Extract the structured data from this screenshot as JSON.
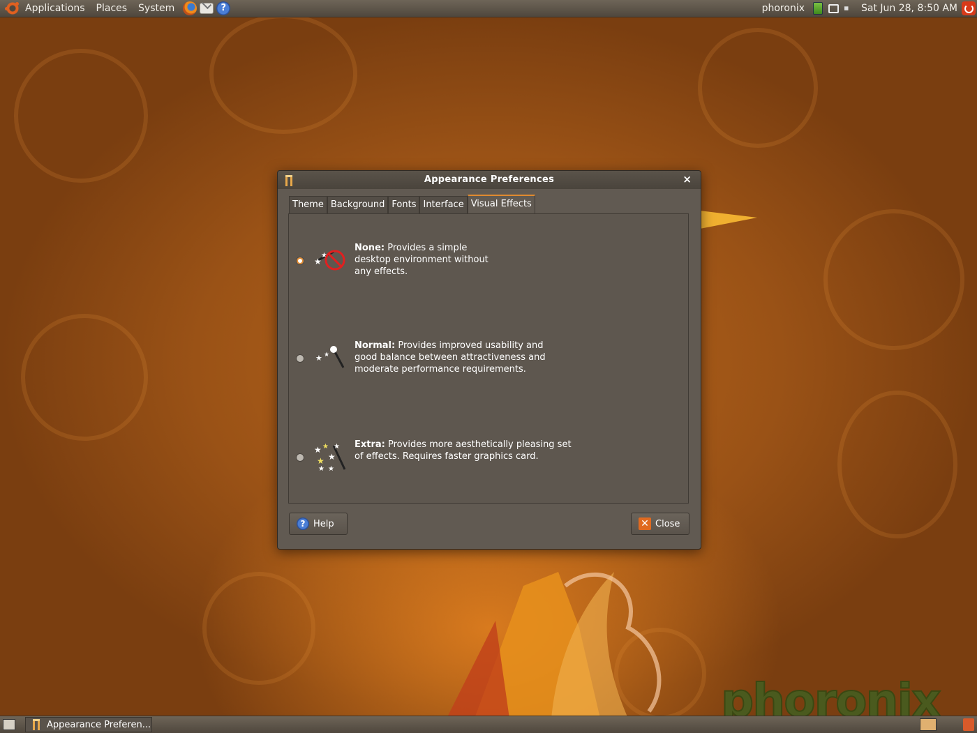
{
  "top_panel": {
    "menus": [
      "Applications",
      "Places",
      "System"
    ],
    "user": "phoronix",
    "clock": "Sat Jun 28,  8:50 AM",
    "icons": [
      "ubuntu-logo",
      "firefox-icon",
      "mail-icon",
      "help-icon",
      "battery-icon",
      "network-icon",
      "volume-icon",
      "power-icon"
    ]
  },
  "dialog": {
    "title": "Appearance Preferences",
    "close_glyph": "×",
    "tabs": [
      {
        "label": "Theme",
        "active": false
      },
      {
        "label": "Background",
        "active": false
      },
      {
        "label": "Fonts",
        "active": false
      },
      {
        "label": "Interface",
        "active": false
      },
      {
        "label": "Visual Effects",
        "active": true
      }
    ],
    "options": [
      {
        "key": "None:",
        "lines": [
          "Provides a simple",
          "desktop environment without",
          "any effects."
        ],
        "selected": true,
        "icon": "no-effects-icon"
      },
      {
        "key": "Normal:",
        "lines": [
          "Provides improved usability and",
          "good balance between attractiveness and",
          "moderate performance requirements."
        ],
        "selected": false,
        "icon": "normal-effects-icon"
      },
      {
        "key": "Extra:",
        "lines": [
          "Provides more aesthetically pleasing set",
          "of effects. Requires faster graphics card."
        ],
        "selected": false,
        "icon": "extra-effects-icon"
      }
    ],
    "help_label": "Help",
    "close_label": "Close"
  },
  "bottom_panel": {
    "task_label": "Appearance Preferen..."
  },
  "watermark": "phoronix"
}
